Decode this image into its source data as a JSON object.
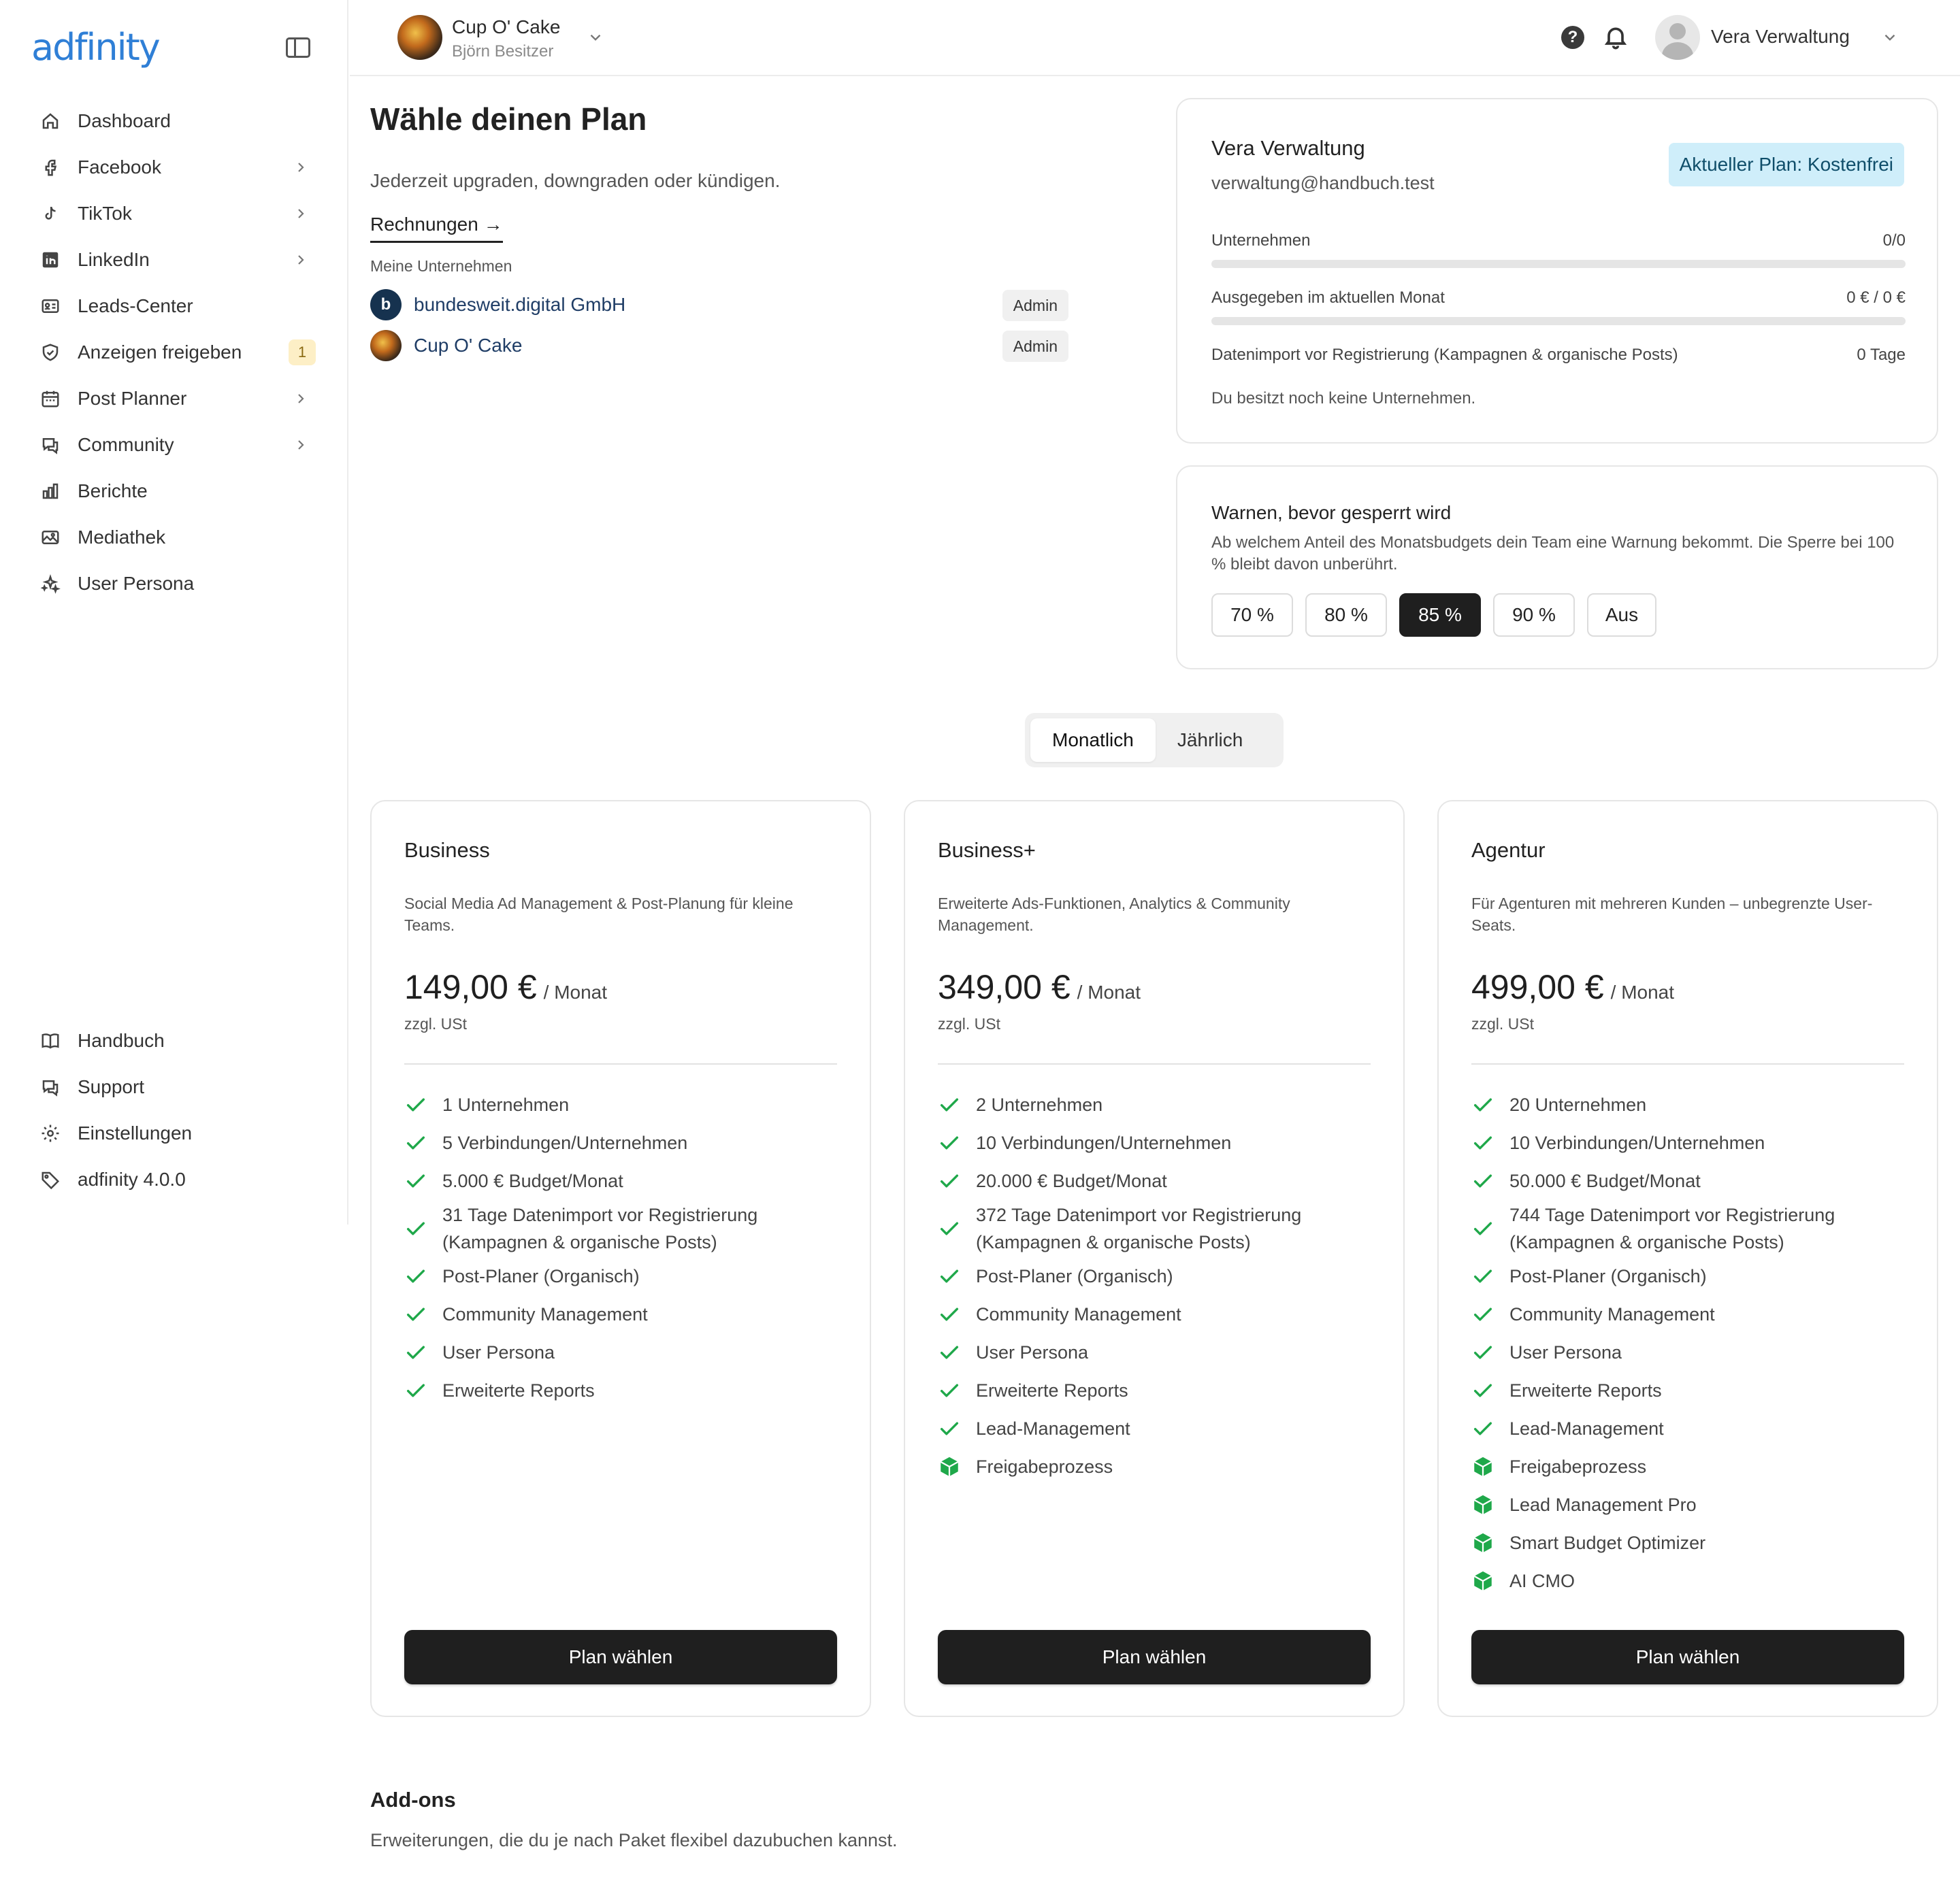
{
  "brand": {
    "name": "adfinity"
  },
  "sidebar": {
    "items": [
      {
        "label": "Dashboard",
        "icon": "home-icon",
        "chevron": false
      },
      {
        "label": "Facebook",
        "icon": "facebook-icon",
        "chevron": true
      },
      {
        "label": "TikTok",
        "icon": "tiktok-icon",
        "chevron": true
      },
      {
        "label": "LinkedIn",
        "icon": "linkedin-icon",
        "chevron": true
      },
      {
        "label": "Leads-Center",
        "icon": "id-card-icon",
        "chevron": false
      },
      {
        "label": "Anzeigen freigeben",
        "icon": "shield-check-icon",
        "chevron": false,
        "badge": "1"
      },
      {
        "label": "Post Planner",
        "icon": "calendar-icon",
        "chevron": true
      },
      {
        "label": "Community",
        "icon": "chat-icon",
        "chevron": true
      },
      {
        "label": "Berichte",
        "icon": "bar-chart-icon",
        "chevron": false
      },
      {
        "label": "Mediathek",
        "icon": "image-icon",
        "chevron": false
      },
      {
        "label": "User Persona",
        "icon": "sparkles-icon",
        "chevron": false
      }
    ],
    "bottom_items": [
      {
        "label": "Handbuch",
        "icon": "book-icon"
      },
      {
        "label": "Support",
        "icon": "chat-icon"
      },
      {
        "label": "Einstellungen",
        "icon": "gear-icon"
      },
      {
        "label": "adfinity 4.0.0",
        "icon": "tag-icon"
      }
    ]
  },
  "header": {
    "company_name": "Cup O' Cake",
    "company_sub": "Björn Besitzer",
    "user_name": "Vera Verwaltung"
  },
  "main": {
    "title": "Wähle deinen Plan",
    "subtitle": "Jederzeit upgraden, downgraden oder kündigen.",
    "invoices_link": "Rechnungen →",
    "companies_label": "Meine Unternehmen",
    "companies": [
      {
        "name": "bundesweit.digital GmbH",
        "role": "Admin",
        "icon_color": "#16324f",
        "icon_glyph": "b"
      },
      {
        "name": "Cup O' Cake",
        "role": "Admin",
        "icon_color": "#8a4a1c",
        "icon_glyph": ""
      }
    ]
  },
  "account": {
    "name": "Vera Verwaltung",
    "email": "verwaltung@handbuch.test",
    "plan_badge": "Aktueller Plan: Kostenfrei",
    "metrics": [
      {
        "label": "Unternehmen",
        "value": "0/0",
        "fill": 0,
        "bar": true
      },
      {
        "label": "Ausgegeben im aktuellen Monat",
        "value": "0 € / 0 €",
        "fill": 0,
        "bar": true
      },
      {
        "label": "Datenimport vor Registrierung (Kampagnen & organische Posts)",
        "value": "0 Tage",
        "bar": false
      }
    ],
    "note": "Du besitzt noch keine Unternehmen."
  },
  "warning": {
    "title": "Warnen, bevor gesperrt wird",
    "description": "Ab welchem Anteil des Monatsbudgets dein Team eine Warnung bekommt. Die Sperre bei 100 % bleibt davon unberührt.",
    "options": [
      "70 %",
      "80 %",
      "85 %",
      "90 %",
      "Aus"
    ],
    "selected": "85 %"
  },
  "billing": {
    "monthly": "Monatlich",
    "yearly": "Jährlich",
    "selected": "monthly"
  },
  "colors": {
    "check": "#1fa84a",
    "addon": "#1fa84a",
    "primary_button": "#1f1f1f"
  },
  "plans": [
    {
      "name": "Business",
      "description": "Social Media Ad Management & Post-Planung für kleine Teams.",
      "price": "149,00 €",
      "period": "/ Monat",
      "tax": "zzgl. USt",
      "button": "Plan wählen",
      "features": [
        {
          "label": "1 Unternehmen",
          "type": "check"
        },
        {
          "label": "5 Verbindungen/Unternehmen",
          "type": "check"
        },
        {
          "label": "5.000 € Budget/Monat",
          "type": "check"
        },
        {
          "label": "31 Tage Datenimport vor Registrierung (Kampagnen & organische Posts)",
          "type": "check",
          "double": true
        },
        {
          "label": "Post-Planer (Organisch)",
          "type": "check"
        },
        {
          "label": "Community Management",
          "type": "check"
        },
        {
          "label": "User Persona",
          "type": "check"
        },
        {
          "label": "Erweiterte Reports",
          "type": "check"
        }
      ]
    },
    {
      "name": "Business+",
      "description": "Erweiterte Ads-Funktionen, Analytics & Community Management.",
      "price": "349,00 €",
      "period": "/ Monat",
      "tax": "zzgl. USt",
      "button": "Plan wählen",
      "features": [
        {
          "label": "2 Unternehmen",
          "type": "check"
        },
        {
          "label": "10 Verbindungen/Unternehmen",
          "type": "check"
        },
        {
          "label": "20.000 € Budget/Monat",
          "type": "check"
        },
        {
          "label": "372 Tage Datenimport vor Registrierung (Kampagnen & organische Posts)",
          "type": "check",
          "double": true
        },
        {
          "label": "Post-Planer (Organisch)",
          "type": "check"
        },
        {
          "label": "Community Management",
          "type": "check"
        },
        {
          "label": "User Persona",
          "type": "check"
        },
        {
          "label": "Erweiterte Reports",
          "type": "check"
        },
        {
          "label": "Lead-Management",
          "type": "check"
        },
        {
          "label": "Freigabeprozess",
          "type": "addon"
        }
      ]
    },
    {
      "name": "Agentur",
      "description": "Für Agenturen mit mehreren Kunden – unbegrenzte User-Seats.",
      "price": "499,00 €",
      "period": "/ Monat",
      "tax": "zzgl. USt",
      "button": "Plan wählen",
      "features": [
        {
          "label": "20 Unternehmen",
          "type": "check"
        },
        {
          "label": "10 Verbindungen/Unternehmen",
          "type": "check"
        },
        {
          "label": "50.000 € Budget/Monat",
          "type": "check"
        },
        {
          "label": "744 Tage Datenimport vor Registrierung (Kampagnen & organische Posts)",
          "type": "check",
          "double": true
        },
        {
          "label": "Post-Planer (Organisch)",
          "type": "check"
        },
        {
          "label": "Community Management",
          "type": "check"
        },
        {
          "label": "User Persona",
          "type": "check"
        },
        {
          "label": "Erweiterte Reports",
          "type": "check"
        },
        {
          "label": "Lead-Management",
          "type": "check"
        },
        {
          "label": "Freigabeprozess",
          "type": "addon"
        },
        {
          "label": "Lead Management Pro",
          "type": "addon"
        },
        {
          "label": "Smart Budget Optimizer",
          "type": "addon"
        },
        {
          "label": "AI CMO",
          "type": "addon"
        }
      ]
    }
  ],
  "addons": {
    "title": "Add-ons",
    "subtitle": "Erweiterungen, die du je nach Paket flexibel dazubuchen kannst."
  }
}
